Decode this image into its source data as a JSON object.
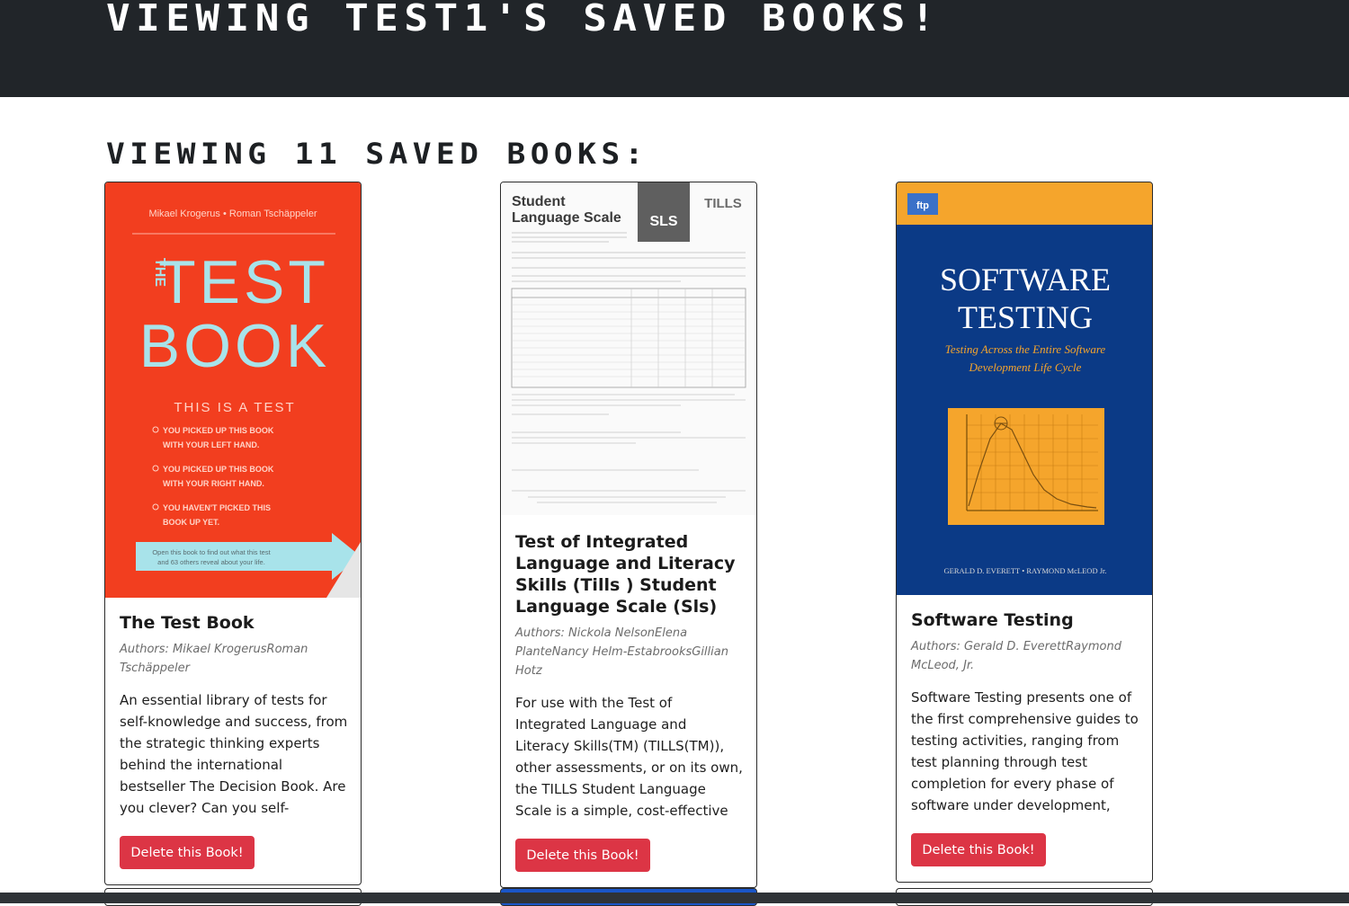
{
  "header": {
    "title": "VIEWING TEST1'S SAVED BOOKS!"
  },
  "main": {
    "count_heading": "VIEWING 11 SAVED BOOKS:"
  },
  "books": [
    {
      "title": "The Test Book",
      "authors": "Authors: Mikael KrogerusRoman Tschäppeler",
      "description": "An essential library of tests for self-knowledge and success, from the strategic thinking experts behind the international bestseller The Decision Book. Are you clever? Can you self-",
      "delete_label": "Delete this Book!",
      "cover": {
        "authors": "Mikael Krogerus • Roman Tschäppeler",
        "the": "THE",
        "word1": "TEST",
        "word2": "BOOK",
        "subtitle": "THIS IS A TEST",
        "opt1a": "YOU PICKED UP THIS BOOK",
        "opt1b": "WITH YOUR LEFT HAND.",
        "opt2a": "YOU PICKED UP THIS BOOK",
        "opt2b": "WITH YOUR RIGHT HAND.",
        "opt3a": "YOU HAVEN'T PICKED THIS",
        "opt3b": "BOOK UP YET.",
        "arrow1": "Open this book to find out what this test",
        "arrow2": "and 63 others reveal about your life."
      }
    },
    {
      "title": "Test of Integrated Language and Literacy Skills (Tills ) Student Language Scale (Sls)",
      "authors": "Authors: Nickola NelsonElena PlanteNancy Helm-EstabrooksGillian Hotz",
      "description": "For use with the Test of Integrated Language and Literacy Skills(TM) (TILLS(TM)), other assessments, or on its own, the TILLS Student Language Scale is a simple, cost-effective way to",
      "delete_label": "Delete this Book!",
      "cover": {
        "line1": "Student",
        "line2": "Language Scale",
        "badge": "SLS",
        "logo": "TILLS"
      }
    },
    {
      "title": "Software Testing",
      "authors": "Authors: Gerald D. EverettRaymond McLeod, Jr.",
      "description": "Software Testing presents one of the first comprehensive guides to testing activities, ranging from test planning through test completion for every phase of software under development, and",
      "delete_label": "Delete this Book!",
      "cover": {
        "badge": "ftp",
        "title1": "SOFTWARE",
        "title2": "TESTING",
        "sub1": "Testing Across the Entire Software",
        "sub2": "Development Life Cycle",
        "authors": "GERALD D. EVERETT • RAYMOND McLEOD Jr."
      }
    }
  ],
  "colors": {
    "hero": "#212529",
    "danger": "#dc3545",
    "cover_red": "#f23e1f",
    "cover_teal": "#a8e3ea",
    "cover_blue": "#0b3a86",
    "cover_orange": "#f5a52c"
  }
}
